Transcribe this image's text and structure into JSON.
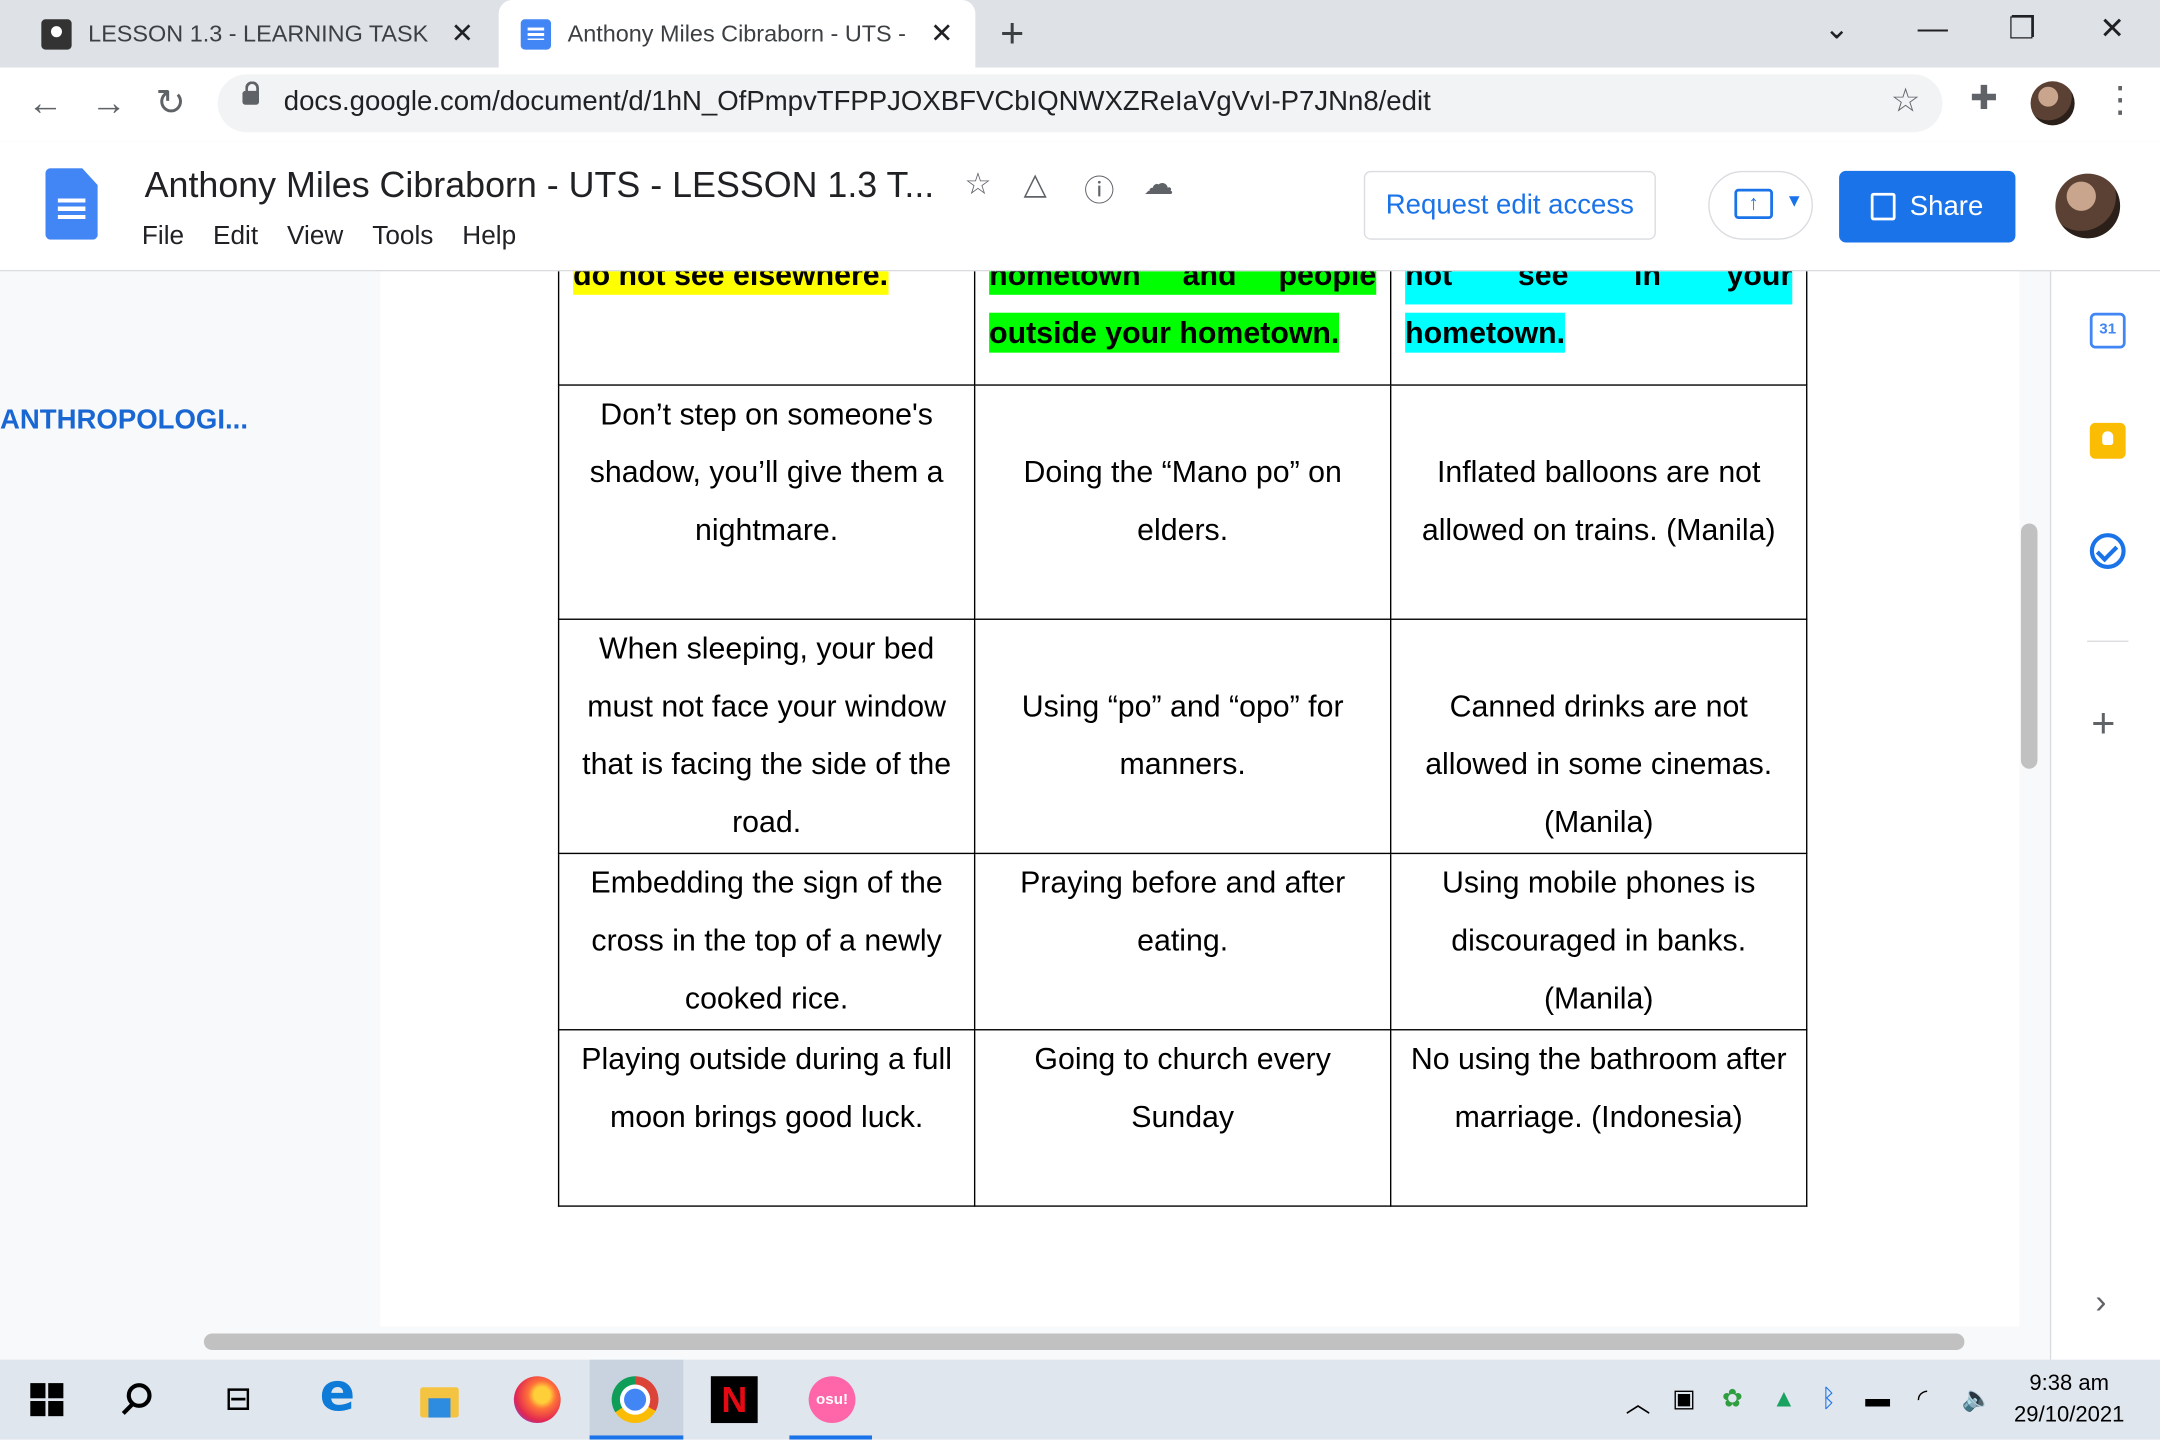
{
  "browser": {
    "tabs": [
      {
        "title": "LESSON 1.3 - LEARNING TASK",
        "active": false
      },
      {
        "title": "Anthony Miles Cibraborn - UTS -",
        "active": true
      }
    ],
    "url": "docs.google.com/document/d/1hN_OfPmpvTFPPJOXBFVCbIQNWXZReIaVgVvI-P7JNn8/edit"
  },
  "docs": {
    "title": "Anthony Miles Cibraborn - UTS - LESSON 1.3 T...",
    "menu": [
      "File",
      "Edit",
      "View",
      "Tools",
      "Help"
    ],
    "request_access": "Request edit access",
    "share": "Share",
    "outline_item": "ANTHROPOLOGI...",
    "calendar_day": "31"
  },
  "table": {
    "header_fragments": [
      {
        "lines": [
          "do not see elsewhere."
        ],
        "color": "#ffff00"
      },
      {
        "lines": [
          "hometown and people",
          "outside your hometown."
        ],
        "color": "#00ff00"
      },
      {
        "lines": [
          "not see in your",
          "hometown."
        ],
        "color": "#00ffff"
      }
    ],
    "rows": [
      [
        "Don’t step on someone's shadow, you’ll give them a nightmare.",
        "Doing the “Mano po” on elders.",
        "Inflated balloons are not allowed on trains. (Manila)"
      ],
      [
        "When sleeping, your bed must not face your window that is facing the side of the road.",
        "Using “po” and “opo” for manners.",
        "Canned drinks are not allowed in some cinemas. (Manila)"
      ],
      [
        "Embedding the sign of the cross in the top of a newly cooked rice.",
        "Praying before and after eating.",
        "Using mobile phones is discouraged in banks. (Manila)"
      ],
      [
        "Playing outside during a full moon brings good luck.",
        "Going to church every Sunday",
        "No using the bathroom after marriage. (Indonesia)"
      ]
    ]
  },
  "taskbar": {
    "time": "9:38 am",
    "date": "29/10/2021",
    "netflix": "N",
    "osu": "osu!"
  }
}
